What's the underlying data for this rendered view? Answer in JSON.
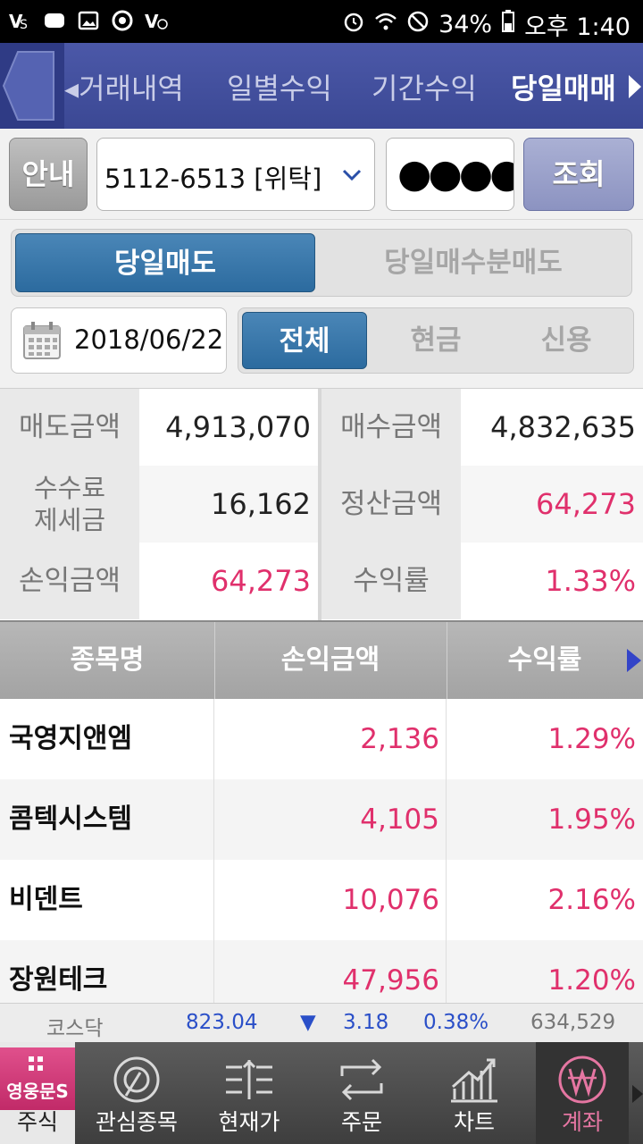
{
  "status_bar": {
    "battery": "34%",
    "time": "오후 1:40"
  },
  "tabs": [
    {
      "label": "◂거래내역"
    },
    {
      "label": "일별수익"
    },
    {
      "label": "기간수익"
    },
    {
      "label": "당일매매"
    }
  ],
  "account": {
    "guide_label": "안내",
    "account_number": "5112-6513 [위탁]",
    "password_mask": "●●●●",
    "query_label": "조회"
  },
  "segment_trade": {
    "options": [
      "당일매도",
      "당일매수분매도"
    ],
    "selected": "당일매도"
  },
  "date": "2018/06/22",
  "segment_type": {
    "options": [
      "전체",
      "현금",
      "신용"
    ],
    "selected": "전체"
  },
  "summary": {
    "sell_amount_label": "매도금액",
    "sell_amount": "4,913,070",
    "buy_amount_label": "매수금액",
    "buy_amount": "4,832,635",
    "fee_label_1": "수수료",
    "fee_label_2": "제세금",
    "fee_amount": "16,162",
    "settle_label": "정산금액",
    "settle_amount": "64,273",
    "pl_label": "손익금액",
    "pl_amount": "64,273",
    "return_label": "수익률",
    "return_rate": "1.33%"
  },
  "list": {
    "columns": [
      "종목명",
      "손익금액",
      "수익률"
    ],
    "rows": [
      {
        "name": "국영지앤엠",
        "pl": "2,136",
        "rate": "1.29%"
      },
      {
        "name": "콤텍시스템",
        "pl": "4,105",
        "rate": "1.95%"
      },
      {
        "name": "비덴트",
        "pl": "10,076",
        "rate": "2.16%"
      },
      {
        "name": "장원테크",
        "pl": "47,956",
        "rate": "1.20%"
      }
    ]
  },
  "ticker": {
    "index_name": "코스닥",
    "value": "823.04",
    "direction": "▼",
    "change": "3.18",
    "change_pct": "0.38%",
    "volume": "634,529"
  },
  "bottom_nav": {
    "items": [
      "주식",
      "관심종목",
      "현재가",
      "주문",
      "차트",
      "계좌"
    ],
    "selected": "계좌"
  },
  "colors": {
    "header_blue": "#4b58a8",
    "accent_pink": "#e0306c",
    "segment_blue": "#2c6b9f"
  }
}
